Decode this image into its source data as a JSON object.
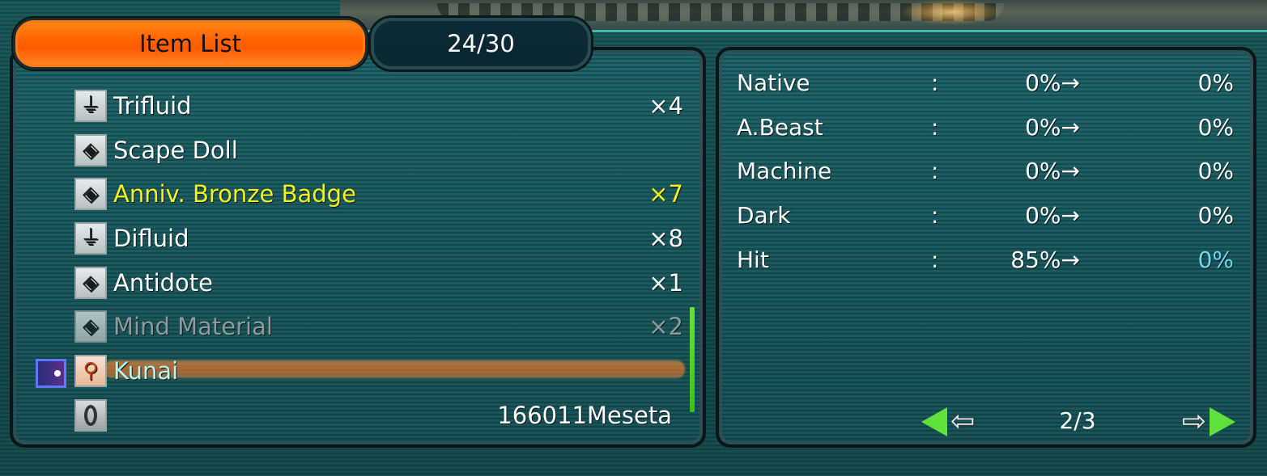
{
  "tabs": {
    "item_list_label": "Item List",
    "count_label": "24/30"
  },
  "items": [
    {
      "icon": "fluid-icon",
      "name": "Trifluid",
      "qty": "×4"
    },
    {
      "icon": "diamond-icon",
      "name": "Scape Doll",
      "qty": ""
    },
    {
      "icon": "diamond-icon",
      "name": "Anniv. Bronze Badge",
      "qty": "×7"
    },
    {
      "icon": "fluid-icon",
      "name": "Difluid",
      "qty": "×8"
    },
    {
      "icon": "diamond-icon",
      "name": "Antidote",
      "qty": "×1"
    },
    {
      "icon": "diamond-icon",
      "name": "Mind Material",
      "qty": "×2"
    },
    {
      "icon": "weapon-icon",
      "name": "Kunai",
      "qty": ""
    },
    {
      "icon": "meseta-icon",
      "name": "",
      "qty": "166011Meseta"
    }
  ],
  "stats": [
    {
      "label": "Native",
      "colon": ":",
      "from": "0%→",
      "to": "0%"
    },
    {
      "label": "A.Beast",
      "colon": ":",
      "from": "0%→",
      "to": "0%"
    },
    {
      "label": "Machine",
      "colon": ":",
      "from": "0%→",
      "to": "0%"
    },
    {
      "label": "Dark",
      "colon": ":",
      "from": "0%→",
      "to": "0%"
    },
    {
      "label": "Hit",
      "colon": ":",
      "from": "85%→",
      "to": "0%"
    }
  ],
  "pager": {
    "page_label": "2/3"
  },
  "colors": {
    "highlight_yellow": "#f2f21c",
    "dim_grey": "#8c9b9b",
    "selected_text": "#b8f4ee",
    "cyan_value": "#6fd8ef",
    "accent_orange": "#ff6a00",
    "accent_green": "#5fe03a"
  }
}
